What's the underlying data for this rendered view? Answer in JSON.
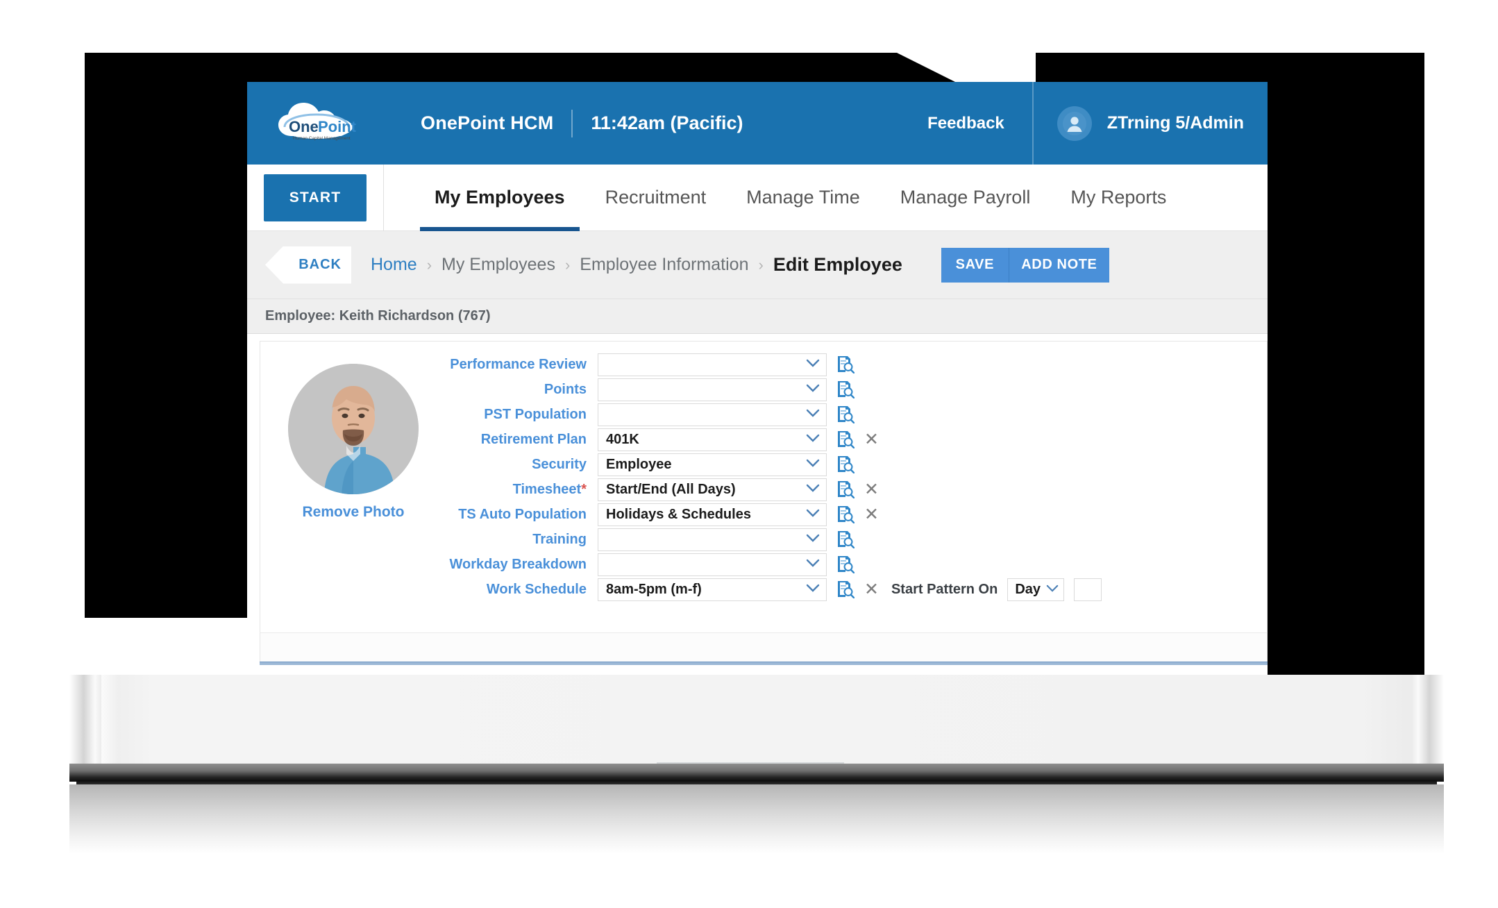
{
  "topbar": {
    "logo_icon": "onepoint-cloud-logo",
    "logo_text": "OnePoint",
    "logo_tagline": "Human Capital Management",
    "brand": "OnePoint HCM",
    "clock": "11:42am (Pacific)",
    "feedback_label": "Feedback",
    "avatar_icon": "user-avatar-icon",
    "username": "ZTrning 5/Admin",
    "color": "#1A72AF"
  },
  "nav": {
    "start_label": "START",
    "tabs": [
      {
        "label": "My Employees",
        "active": true
      },
      {
        "label": "Recruitment",
        "active": false
      },
      {
        "label": "Manage Time",
        "active": false
      },
      {
        "label": "Manage Payroll",
        "active": false
      },
      {
        "label": "My Reports",
        "active": false
      }
    ],
    "active_underline_color": "#18558F"
  },
  "breadcrumb": {
    "back_label": "BACK",
    "items": [
      {
        "label": "Home",
        "type": "link"
      },
      {
        "label": "My Employees",
        "type": "link"
      },
      {
        "label": "Employee Information",
        "type": "link"
      },
      {
        "label": "Edit Employee",
        "type": "current"
      }
    ],
    "separator": "›",
    "save_label": "SAVE",
    "add_note_label": "ADD NOTE",
    "button_color": "#4A90D9"
  },
  "employee_bar": {
    "text": "Employee: Keith Richardson (767)"
  },
  "photo": {
    "alt_name": "employee-photo",
    "remove_label": "Remove Photo"
  },
  "form": {
    "chevron_icon": "chevron-down-icon",
    "lookup_icon": "document-search-icon",
    "clear_icon": "close-x-icon",
    "label_color": "#4A90D9",
    "fields": [
      {
        "label": "Performance Review",
        "required": false,
        "value": "",
        "lookup": true,
        "clear": false
      },
      {
        "label": "Points",
        "required": false,
        "value": "",
        "lookup": true,
        "clear": false
      },
      {
        "label": "PST Population",
        "required": false,
        "value": "",
        "lookup": true,
        "clear": false
      },
      {
        "label": "Retirement Plan",
        "required": false,
        "value": "401K",
        "lookup": true,
        "clear": true
      },
      {
        "label": "Security",
        "required": false,
        "value": "Employee",
        "lookup": true,
        "clear": false
      },
      {
        "label": "Timesheet",
        "required": true,
        "value": "Start/End (All Days)",
        "lookup": true,
        "clear": true
      },
      {
        "label": "TS Auto Population",
        "required": false,
        "value": "Holidays & Schedules",
        "lookup": true,
        "clear": true
      },
      {
        "label": "Training",
        "required": false,
        "value": "",
        "lookup": true,
        "clear": false
      },
      {
        "label": "Workday Breakdown",
        "required": false,
        "value": "",
        "lookup": true,
        "clear": false
      },
      {
        "label": "Work Schedule",
        "required": false,
        "value": "8am-5pm (m-f)",
        "lookup": true,
        "clear": true,
        "extra": {
          "inline_label": "Start Pattern On",
          "day_value": "Day"
        }
      }
    ]
  }
}
